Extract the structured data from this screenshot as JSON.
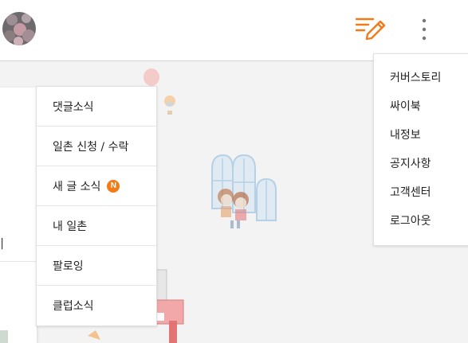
{
  "colors": {
    "accent": "#f27b17",
    "background": "#f3f3f3"
  },
  "header": {
    "avatar_icon": "profile-avatar",
    "write_icon": "write-pencil-icon",
    "more_icon": "vertical-more-icon"
  },
  "left_panel": {
    "fragment_text": "|"
  },
  "notification_menu": {
    "items": [
      {
        "label": "댓글소식"
      },
      {
        "label": "일촌 신청 / 수락"
      },
      {
        "label": "새 글 소식",
        "badge": "N"
      },
      {
        "label": "내 일촌"
      },
      {
        "label": "팔로잉"
      },
      {
        "label": "클럽소식"
      }
    ]
  },
  "more_menu": {
    "items": [
      {
        "label": "커버스토리"
      },
      {
        "label": "싸이북"
      },
      {
        "label": "내정보"
      },
      {
        "label": "공지사항"
      },
      {
        "label": "고객센터"
      },
      {
        "label": "로그아웃"
      }
    ]
  }
}
